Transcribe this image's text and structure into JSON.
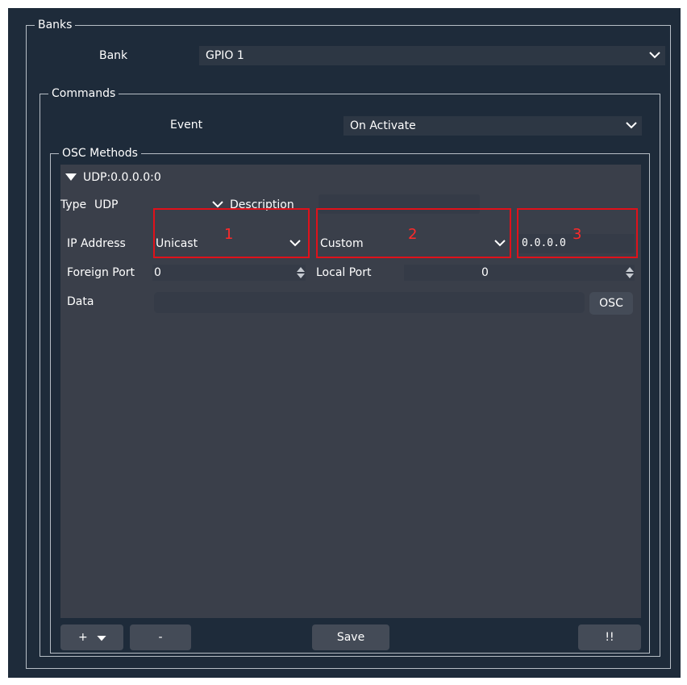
{
  "banks": {
    "title": "Banks",
    "bank_label": "Bank",
    "bank_value": "GPIO 1"
  },
  "commands": {
    "title": "Commands",
    "event_label": "Event",
    "event_value": "On Activate"
  },
  "osc": {
    "title": "OSC Methods",
    "tree_item": "UDP:0.0.0.0:0",
    "type_label": "Type",
    "type_value": "UDP",
    "description_label": "Description",
    "description_value": "",
    "ip_label": "IP Address",
    "ip_mode": "Unicast",
    "ip_select": "Custom",
    "ip_value": "0.0.0.0",
    "foreign_port_label": "Foreign Port",
    "foreign_port_value": "0",
    "local_port_label": "Local Port",
    "local_port_value": "0",
    "data_label": "Data",
    "data_value": "",
    "osc_button": "OSC"
  },
  "annotations": [
    "1",
    "2",
    "3"
  ],
  "toolbar": {
    "add_label": "+",
    "remove_label": "-",
    "save_label": "Save",
    "alert_label": "!!"
  },
  "colors": {
    "background": "#1e2b3a",
    "panel": "#3a3f4a",
    "highlight": "#e0111a"
  }
}
